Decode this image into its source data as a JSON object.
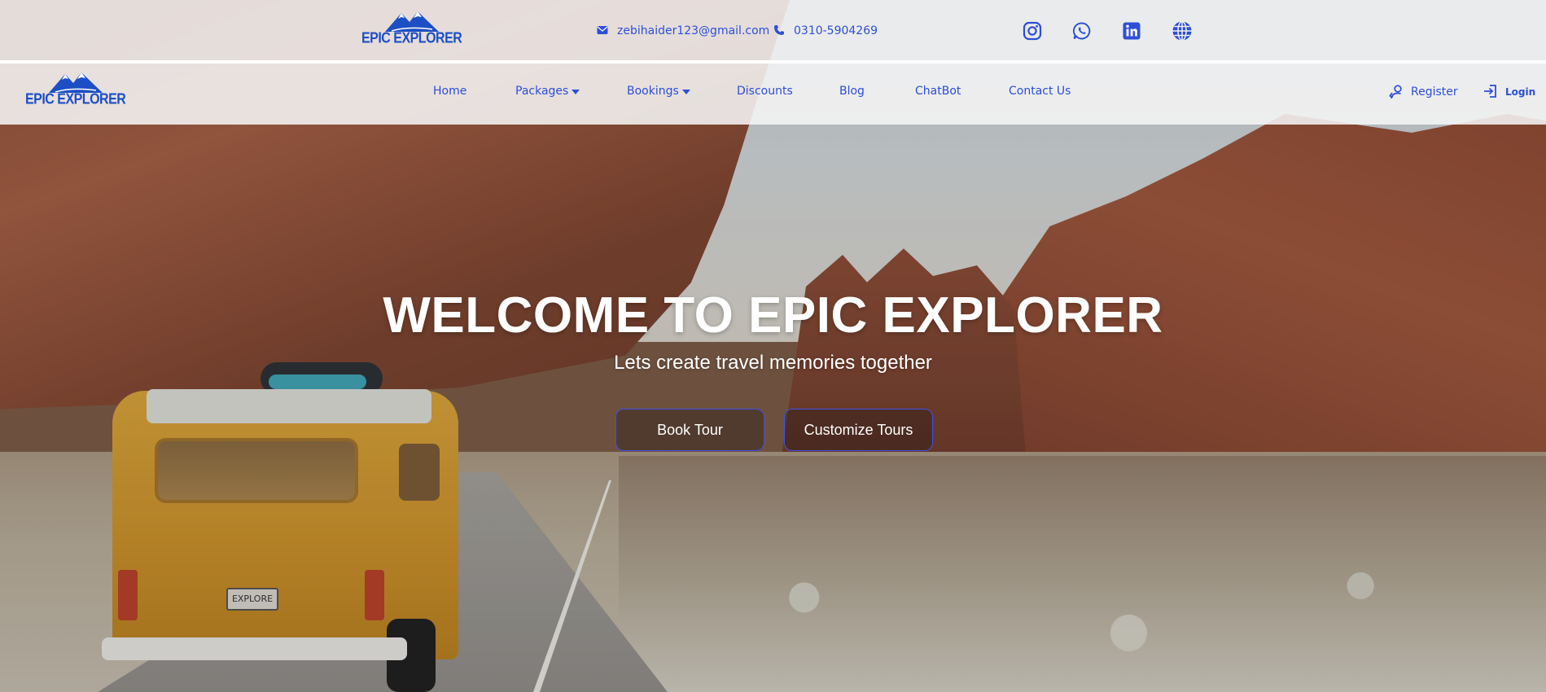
{
  "brand": {
    "logo_text": "EPIC EXPLORER",
    "color": "#1d4fc4"
  },
  "contact": {
    "email": "zebihaider123@gmail.com",
    "email_icon": "envelope-icon",
    "phone": "0310-5904269",
    "phone_icon": "phone-icon"
  },
  "social": [
    {
      "name": "instagram-icon"
    },
    {
      "name": "whatsapp-icon"
    },
    {
      "name": "linkedin-icon"
    },
    {
      "name": "globe-icon"
    }
  ],
  "nav": {
    "items": [
      {
        "label": "Home"
      },
      {
        "label": "Packages",
        "dropdown": true
      },
      {
        "label": "Bookings",
        "dropdown": true
      },
      {
        "label": "Discounts"
      },
      {
        "label": "Blog"
      },
      {
        "label": "ChatBot"
      },
      {
        "label": "Contact Us"
      }
    ],
    "register_label": "Register",
    "login_label": "Login",
    "accent": "#2d4fd6"
  },
  "hero": {
    "title": "WELCOME TO EPIC EXPLORER",
    "subtitle": "Lets create travel memories together",
    "book_label": "Book Tour",
    "customize_label": "Customize Tours",
    "button_border": "#4150e6",
    "van_plate": "EXPLORE"
  }
}
